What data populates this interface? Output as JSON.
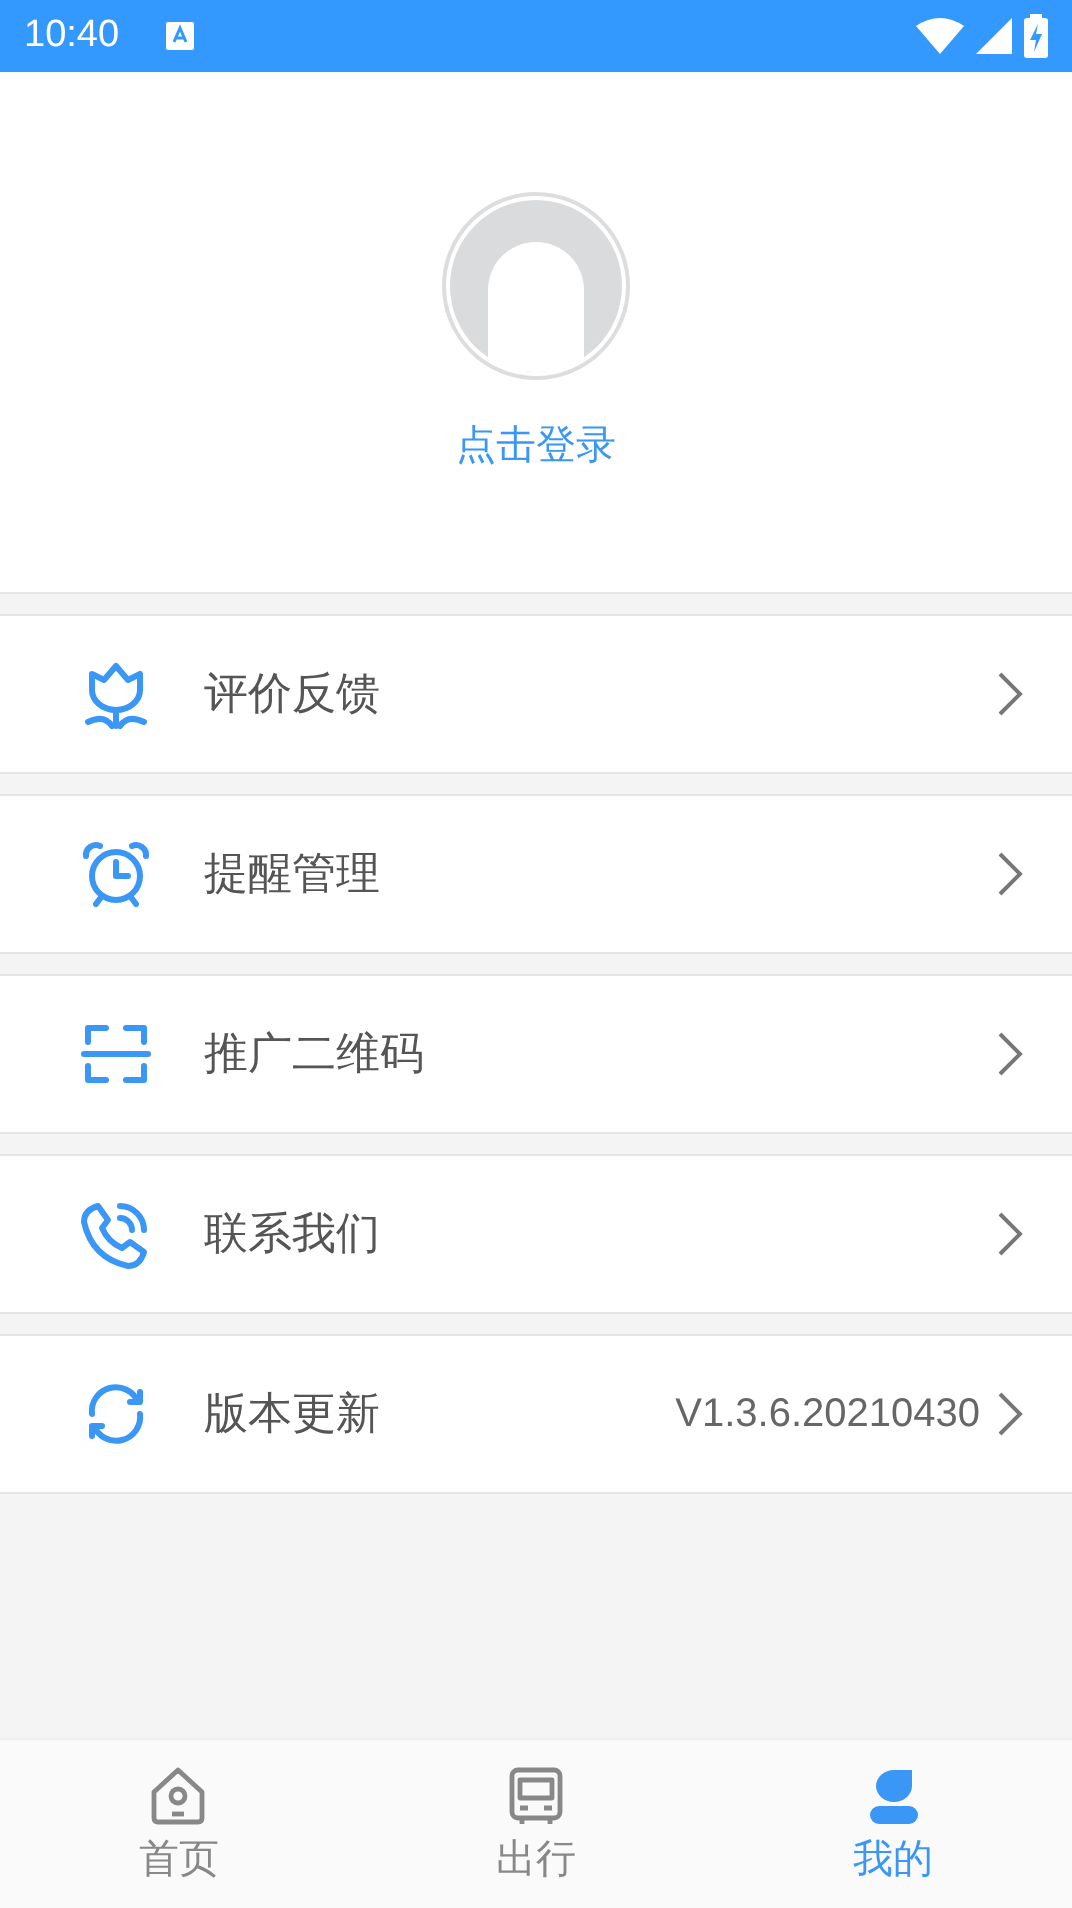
{
  "status_bar": {
    "time": "10:40"
  },
  "profile": {
    "login_label": "点击登录"
  },
  "menu": [
    {
      "kind": "feedback",
      "label": "评价反馈"
    },
    {
      "kind": "alarm",
      "label": "提醒管理"
    },
    {
      "kind": "scan",
      "label": "推广二维码"
    },
    {
      "kind": "phone",
      "label": "联系我们"
    },
    {
      "kind": "refresh",
      "label": "版本更新",
      "value": "V1.3.6.20210430"
    }
  ],
  "tab_bar": [
    {
      "kind": "home",
      "label": "首页",
      "selected": false
    },
    {
      "kind": "bus",
      "label": "出行",
      "selected": false
    },
    {
      "kind": "user",
      "label": "我的",
      "selected": true
    }
  ]
}
